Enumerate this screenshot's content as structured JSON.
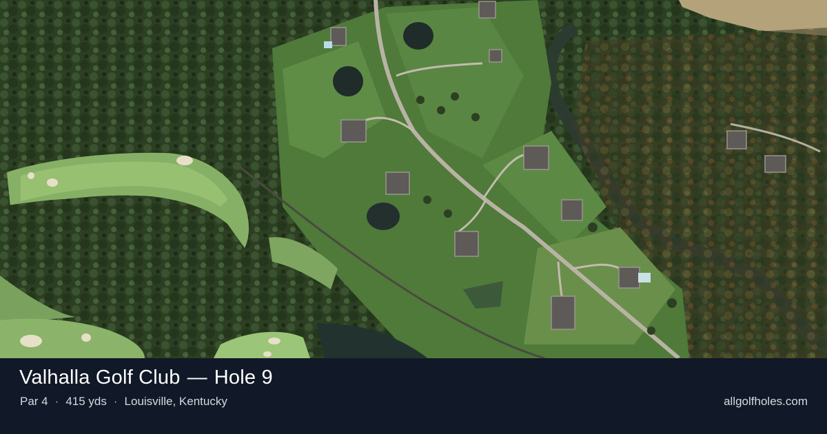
{
  "course": {
    "name": "Valhalla Golf Club",
    "separator": "—",
    "hole_label": "Hole 9"
  },
  "details": {
    "par": "Par 4",
    "distance": "415 yds",
    "location": "Louisville, Kentucky",
    "separator": "·"
  },
  "site": "allgolfholes.com",
  "colors": {
    "footer_background": "#111827",
    "title_text": "#ffffff",
    "meta_text": "#d5d9e0"
  }
}
